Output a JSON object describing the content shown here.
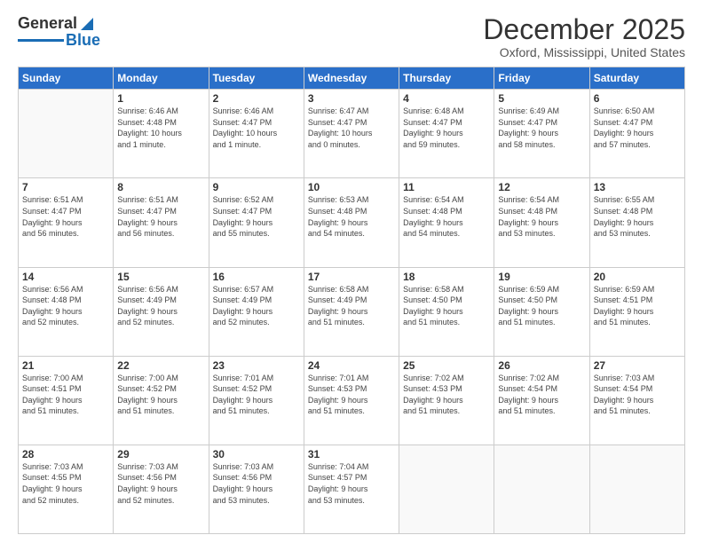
{
  "header": {
    "logo_general": "General",
    "logo_blue": "Blue",
    "title": "December 2025",
    "location": "Oxford, Mississippi, United States"
  },
  "days_of_week": [
    "Sunday",
    "Monday",
    "Tuesday",
    "Wednesday",
    "Thursday",
    "Friday",
    "Saturday"
  ],
  "weeks": [
    [
      {
        "day": "",
        "info": ""
      },
      {
        "day": "1",
        "info": "Sunrise: 6:46 AM\nSunset: 4:48 PM\nDaylight: 10 hours\nand 1 minute."
      },
      {
        "day": "2",
        "info": "Sunrise: 6:46 AM\nSunset: 4:47 PM\nDaylight: 10 hours\nand 1 minute."
      },
      {
        "day": "3",
        "info": "Sunrise: 6:47 AM\nSunset: 4:47 PM\nDaylight: 10 hours\nand 0 minutes."
      },
      {
        "day": "4",
        "info": "Sunrise: 6:48 AM\nSunset: 4:47 PM\nDaylight: 9 hours\nand 59 minutes."
      },
      {
        "day": "5",
        "info": "Sunrise: 6:49 AM\nSunset: 4:47 PM\nDaylight: 9 hours\nand 58 minutes."
      },
      {
        "day": "6",
        "info": "Sunrise: 6:50 AM\nSunset: 4:47 PM\nDaylight: 9 hours\nand 57 minutes."
      }
    ],
    [
      {
        "day": "7",
        "info": "Sunrise: 6:51 AM\nSunset: 4:47 PM\nDaylight: 9 hours\nand 56 minutes."
      },
      {
        "day": "8",
        "info": "Sunrise: 6:51 AM\nSunset: 4:47 PM\nDaylight: 9 hours\nand 56 minutes."
      },
      {
        "day": "9",
        "info": "Sunrise: 6:52 AM\nSunset: 4:47 PM\nDaylight: 9 hours\nand 55 minutes."
      },
      {
        "day": "10",
        "info": "Sunrise: 6:53 AM\nSunset: 4:48 PM\nDaylight: 9 hours\nand 54 minutes."
      },
      {
        "day": "11",
        "info": "Sunrise: 6:54 AM\nSunset: 4:48 PM\nDaylight: 9 hours\nand 54 minutes."
      },
      {
        "day": "12",
        "info": "Sunrise: 6:54 AM\nSunset: 4:48 PM\nDaylight: 9 hours\nand 53 minutes."
      },
      {
        "day": "13",
        "info": "Sunrise: 6:55 AM\nSunset: 4:48 PM\nDaylight: 9 hours\nand 53 minutes."
      }
    ],
    [
      {
        "day": "14",
        "info": "Sunrise: 6:56 AM\nSunset: 4:48 PM\nDaylight: 9 hours\nand 52 minutes."
      },
      {
        "day": "15",
        "info": "Sunrise: 6:56 AM\nSunset: 4:49 PM\nDaylight: 9 hours\nand 52 minutes."
      },
      {
        "day": "16",
        "info": "Sunrise: 6:57 AM\nSunset: 4:49 PM\nDaylight: 9 hours\nand 52 minutes."
      },
      {
        "day": "17",
        "info": "Sunrise: 6:58 AM\nSunset: 4:49 PM\nDaylight: 9 hours\nand 51 minutes."
      },
      {
        "day": "18",
        "info": "Sunrise: 6:58 AM\nSunset: 4:50 PM\nDaylight: 9 hours\nand 51 minutes."
      },
      {
        "day": "19",
        "info": "Sunrise: 6:59 AM\nSunset: 4:50 PM\nDaylight: 9 hours\nand 51 minutes."
      },
      {
        "day": "20",
        "info": "Sunrise: 6:59 AM\nSunset: 4:51 PM\nDaylight: 9 hours\nand 51 minutes."
      }
    ],
    [
      {
        "day": "21",
        "info": "Sunrise: 7:00 AM\nSunset: 4:51 PM\nDaylight: 9 hours\nand 51 minutes."
      },
      {
        "day": "22",
        "info": "Sunrise: 7:00 AM\nSunset: 4:52 PM\nDaylight: 9 hours\nand 51 minutes."
      },
      {
        "day": "23",
        "info": "Sunrise: 7:01 AM\nSunset: 4:52 PM\nDaylight: 9 hours\nand 51 minutes."
      },
      {
        "day": "24",
        "info": "Sunrise: 7:01 AM\nSunset: 4:53 PM\nDaylight: 9 hours\nand 51 minutes."
      },
      {
        "day": "25",
        "info": "Sunrise: 7:02 AM\nSunset: 4:53 PM\nDaylight: 9 hours\nand 51 minutes."
      },
      {
        "day": "26",
        "info": "Sunrise: 7:02 AM\nSunset: 4:54 PM\nDaylight: 9 hours\nand 51 minutes."
      },
      {
        "day": "27",
        "info": "Sunrise: 7:03 AM\nSunset: 4:54 PM\nDaylight: 9 hours\nand 51 minutes."
      }
    ],
    [
      {
        "day": "28",
        "info": "Sunrise: 7:03 AM\nSunset: 4:55 PM\nDaylight: 9 hours\nand 52 minutes."
      },
      {
        "day": "29",
        "info": "Sunrise: 7:03 AM\nSunset: 4:56 PM\nDaylight: 9 hours\nand 52 minutes."
      },
      {
        "day": "30",
        "info": "Sunrise: 7:03 AM\nSunset: 4:56 PM\nDaylight: 9 hours\nand 53 minutes."
      },
      {
        "day": "31",
        "info": "Sunrise: 7:04 AM\nSunset: 4:57 PM\nDaylight: 9 hours\nand 53 minutes."
      },
      {
        "day": "",
        "info": ""
      },
      {
        "day": "",
        "info": ""
      },
      {
        "day": "",
        "info": ""
      }
    ]
  ]
}
